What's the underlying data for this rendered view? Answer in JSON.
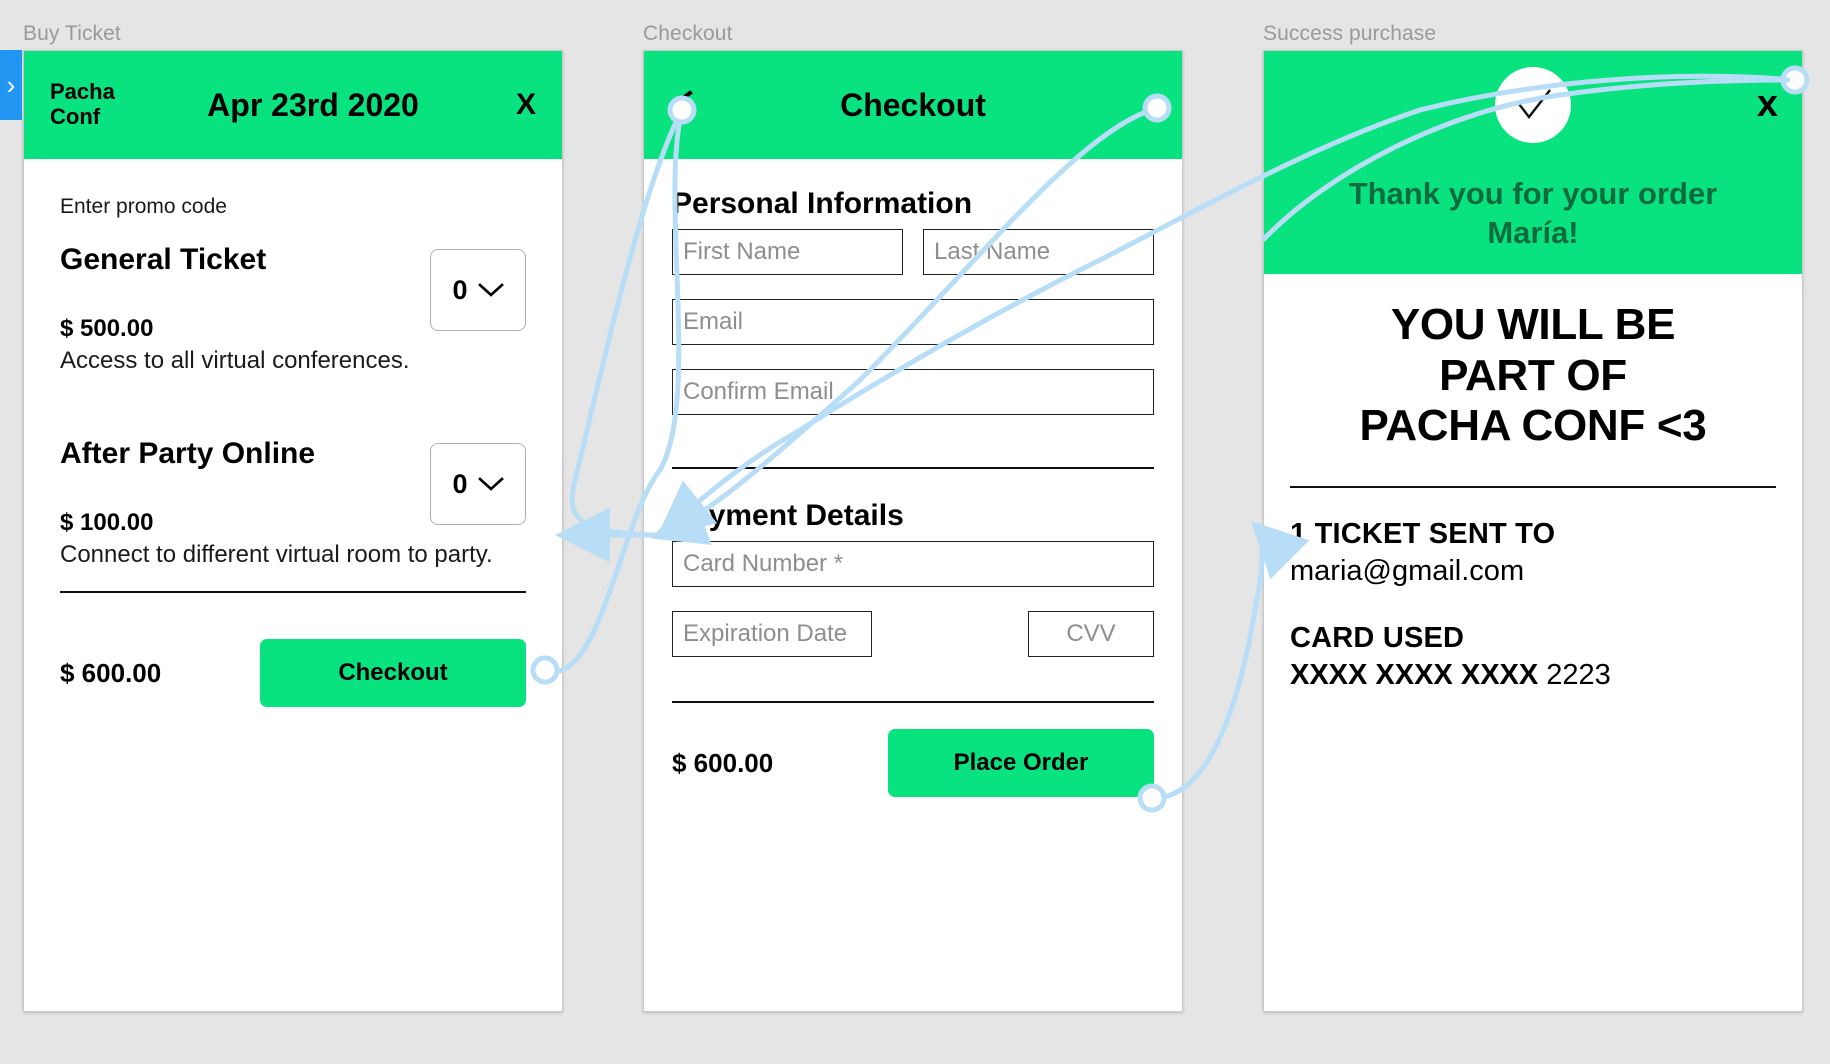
{
  "frames": [
    {
      "label": "Buy Ticket"
    },
    {
      "label": "Checkout"
    },
    {
      "label": "Success purchase"
    }
  ],
  "nav": {
    "left_tab_icon": "chevron-right-icon",
    "left_tab_glyph": "›"
  },
  "buy_ticket": {
    "brand_line1": "Pacha",
    "brand_line2": "Conf",
    "event_date": "Apr 23rd 2020",
    "close_label": "X",
    "promo_label": "Enter promo code",
    "tickets": [
      {
        "name": "General Ticket",
        "price": "$ 500.00",
        "description": "Access to all virtual conferences.",
        "quantity": "0",
        "quantity_icon": "chevron-down-icon"
      },
      {
        "name": "After Party Online",
        "price": "$ 100.00",
        "description": "Connect to different virtual room to party.",
        "quantity": "0",
        "quantity_icon": "chevron-down-icon"
      }
    ],
    "total": "$ 600.00",
    "cta_label": "Checkout"
  },
  "checkout": {
    "title": "Checkout",
    "back_icon": "chevron-left-icon",
    "close_label": "x",
    "personal_section_title": "Personal Information",
    "fields": {
      "first_name": {
        "placeholder": "First Name",
        "value": ""
      },
      "last_name": {
        "placeholder": "Last Name",
        "value": ""
      },
      "email": {
        "placeholder": "Email",
        "value": ""
      },
      "confirm_email": {
        "placeholder": "Confirm Email",
        "value": ""
      }
    },
    "payment_section_title": "Payment Details",
    "payment_fields": {
      "card_number": {
        "placeholder": "Card Number *",
        "value": ""
      },
      "expiration": {
        "placeholder": "Expiration Date",
        "value": ""
      },
      "cvv": {
        "placeholder": "CVV",
        "value": ""
      }
    },
    "total": "$ 600.00",
    "cta_label": "Place Order"
  },
  "success": {
    "close_label": "x",
    "check_icon": "check-circle-icon",
    "thanks_line1": "Thank you for your order",
    "thanks_line2": "María!",
    "headline_line1": "YOU WILL BE",
    "headline_line2": "PART OF",
    "headline_line3": "PACHA CONF <3",
    "ticket_sent_label": "1 TICKET SENT TO",
    "email": "maria@gmail.com",
    "card_used_label": "CARD USED",
    "card_masked": "XXXX XXXX XXXX",
    "card_last4": "2223"
  },
  "colors": {
    "brand_green": "#08e380",
    "connector_blue": "#b8ddf7",
    "tab_blue": "#2196f3",
    "canvas_gray": "#e5e5e5",
    "thanks_green": "#0b6b3c"
  }
}
